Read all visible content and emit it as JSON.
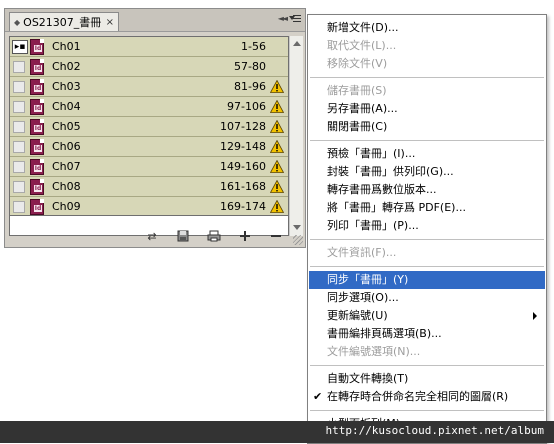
{
  "panel": {
    "tab_title": "OS21307_書冊",
    "close_glyph": "×",
    "chapters": [
      {
        "name": "Ch01",
        "pages": "1-56",
        "open": true,
        "warning": false
      },
      {
        "name": "Ch02",
        "pages": "57-80",
        "open": false,
        "warning": false
      },
      {
        "name": "Ch03",
        "pages": "81-96",
        "open": false,
        "warning": true
      },
      {
        "name": "Ch04",
        "pages": "97-106",
        "open": false,
        "warning": true
      },
      {
        "name": "Ch05",
        "pages": "107-128",
        "open": false,
        "warning": true
      },
      {
        "name": "Ch06",
        "pages": "129-148",
        "open": false,
        "warning": true
      },
      {
        "name": "Ch07",
        "pages": "149-160",
        "open": false,
        "warning": true
      },
      {
        "name": "Ch08",
        "pages": "161-168",
        "open": false,
        "warning": true
      },
      {
        "name": "Ch09",
        "pages": "169-174",
        "open": false,
        "warning": true
      }
    ],
    "footer_icons": [
      "synchronize-icon",
      "save-book-icon",
      "print-book-icon",
      "add-document-icon",
      "remove-document-icon"
    ]
  },
  "menu": {
    "items": [
      {
        "label": "新增文件(D)...",
        "enabled": true
      },
      {
        "label": "取代文件(L)...",
        "enabled": false
      },
      {
        "label": "移除文件(V)",
        "enabled": false
      },
      {
        "separator": true
      },
      {
        "label": "儲存書冊(S)",
        "enabled": false
      },
      {
        "label": "另存書冊(A)...",
        "enabled": true
      },
      {
        "label": "關閉書冊(C)",
        "enabled": true
      },
      {
        "separator": true
      },
      {
        "label": "預檢「書冊」(I)...",
        "enabled": true
      },
      {
        "label": "封裝「書冊」供列印(G)...",
        "enabled": true
      },
      {
        "label": "轉存書冊爲數位版本...",
        "enabled": true
      },
      {
        "label": "將「書冊」轉存爲 PDF(E)...",
        "enabled": true
      },
      {
        "label": "列印「書冊」(P)...",
        "enabled": true
      },
      {
        "separator": true
      },
      {
        "label": "文件資訊(F)...",
        "enabled": false
      },
      {
        "separator": true
      },
      {
        "label": "同步「書冊」(Y)",
        "enabled": true,
        "highlighted": true
      },
      {
        "label": "同步選項(O)...",
        "enabled": true
      },
      {
        "label": "更新編號(U)",
        "enabled": true,
        "submenu": true
      },
      {
        "label": "書冊編排頁碼選項(B)...",
        "enabled": true
      },
      {
        "label": "文件編號選項(N)...",
        "enabled": false
      },
      {
        "separator": true
      },
      {
        "label": "自動文件轉換(T)",
        "enabled": true
      },
      {
        "label": "在轉存時合併命名完全相同的圖層(R)",
        "enabled": true,
        "checked": true
      },
      {
        "separator": true
      },
      {
        "label": "小型面板列(M)",
        "enabled": true
      }
    ]
  },
  "watermark": {
    "url": "http://kusocloud.pixnet.net/album"
  },
  "colors": {
    "row_bg": "#d7d7b7",
    "highlight": "#316ac5",
    "indesign_icon": "#8a1f4e",
    "warning": "#f2c200"
  }
}
